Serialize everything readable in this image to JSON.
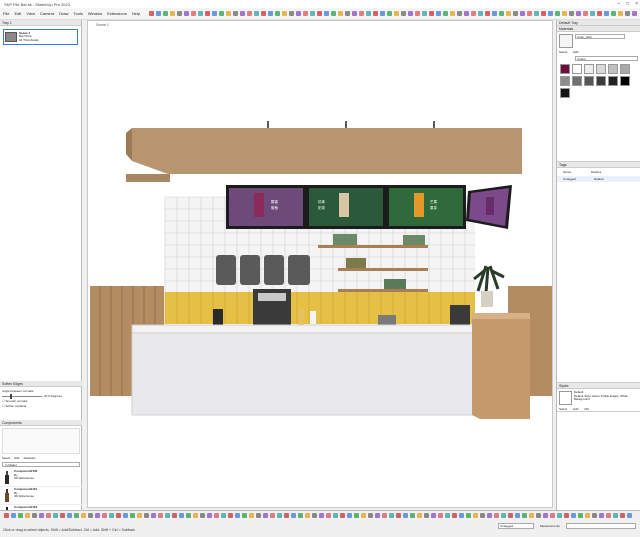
{
  "window": {
    "title": "SKP File Bar.sk - SketchUp Pro 2023"
  },
  "menu": [
    "File",
    "Edit",
    "View",
    "Camera",
    "Draw",
    "Tools",
    "Window",
    "Extensions",
    "Help"
  ],
  "left_panel": {
    "scenes_title": "Tray 1",
    "scene": {
      "name": "Scene 1",
      "line2": "Bar Drink",
      "line3": "All Thumbnails"
    },
    "styles_title": "Soften Edges",
    "soften": {
      "label": "Angle between normals:",
      "value": "20.0 Degrees",
      "smooth_normals": "Smooth normals",
      "soften_coplanar": "Soften coplanar"
    },
    "components_title": "Components",
    "components_tabs": [
      "Select",
      "Edit",
      "Statistics"
    ],
    "components_search": "In Model",
    "components": [
      {
        "name": "Component#100",
        "sub1": "By ...",
        "sub2": "3D Warehouse"
      },
      {
        "name": "Component#110",
        "sub1": "By ...",
        "sub2": "3D Warehouse"
      },
      {
        "name": "Component#119",
        "sub1": "By ...",
        "sub2": "3D Warehouse"
      }
    ],
    "components_footer": "In Model"
  },
  "viewport": {
    "tab": "Scene 1"
  },
  "menu_boards": [
    {
      "line1": "醇香",
      "line2": "葡萄"
    },
    {
      "line1": "珍珠",
      "line2": "奶茶"
    },
    {
      "line1": "芒果",
      "line2": "果茶"
    },
    {
      "line1": "",
      "line2": ""
    }
  ],
  "right_panel": {
    "tray_title": "Default Tray",
    "materials_title": "Materials",
    "materials_name": "Color_G03",
    "materials_tabs": [
      "Select",
      "Edit"
    ],
    "materials_dropdown": "Colors",
    "swatches": [
      "#6b0f3a",
      "#ffffff",
      "#eeeeee",
      "#d9d9d9",
      "#c0c0c0",
      "#a8a8a8",
      "#8c8c8c",
      "#707070",
      "#575757",
      "#3c3c3c",
      "#222222",
      "#000000",
      "#141414"
    ],
    "tags_title": "Tags",
    "tags_header": [
      "Name",
      "Dashes"
    ],
    "tags": [
      {
        "name": "Untagged",
        "dashes": "Default"
      }
    ],
    "styles_title": "Styles",
    "style": {
      "name": "Default",
      "desc": "Default Style where Profile Edges, White Background"
    },
    "styles_tabs": [
      "Select",
      "Edit",
      "Mix"
    ]
  },
  "status": {
    "text": "Click or drag to select objects. Shift = Add/Subtract. Ctrl = Add. Shift + Ctrl = Subtract.",
    "measurements_label": "Measurements",
    "tag_field": "Untagged"
  }
}
